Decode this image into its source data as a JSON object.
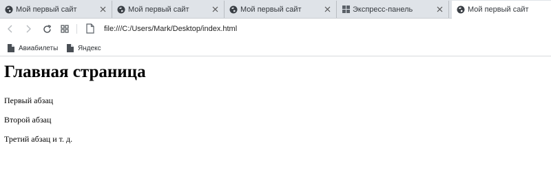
{
  "tabs": [
    {
      "label": "Мой первый сайт",
      "icon": "globe-icon",
      "active": false
    },
    {
      "label": "Мой первый сайт",
      "icon": "globe-icon",
      "active": false
    },
    {
      "label": "Мой первый сайт",
      "icon": "globe-icon",
      "active": false
    },
    {
      "label": "Экспресс-панель",
      "icon": "speed-dial-grid-icon",
      "active": false
    },
    {
      "label": "Мой первый сайт",
      "icon": "globe-icon",
      "active": true
    }
  ],
  "toolbar": {
    "url": "file:///C:/Users/Mark/Desktop/index.html"
  },
  "bookmarks": [
    {
      "label": "Авиабилеты",
      "icon": "document-icon"
    },
    {
      "label": "Яндекс",
      "icon": "document-icon"
    }
  ],
  "page": {
    "heading": "Главная страница",
    "paragraphs": [
      "Первый абзац",
      "Второй абзац",
      "Третий абзац и т. д."
    ]
  },
  "colors": {
    "tabstrip_bg": "#dfe3e8",
    "active_tab_bg": "#ffffff",
    "icon_gray": "#5b6168"
  }
}
